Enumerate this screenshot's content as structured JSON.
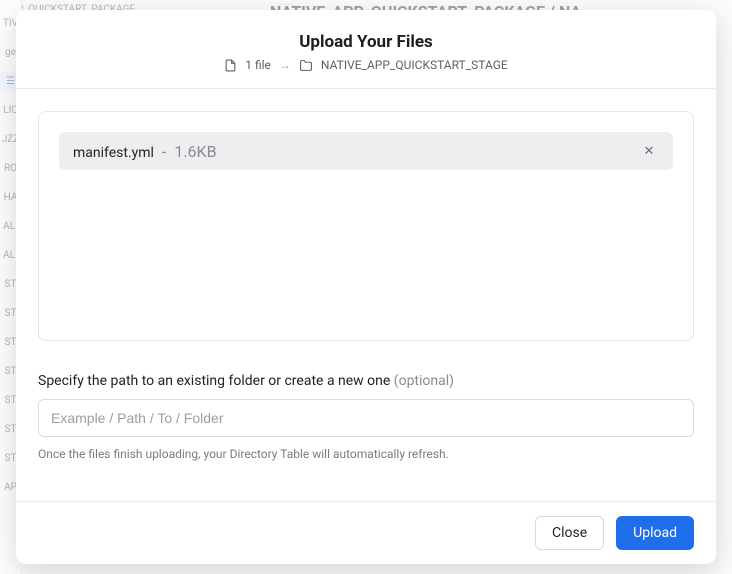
{
  "bg": {
    "header_fragment": "_APP_QUICKSTART_PACKAGE",
    "breadcrumb": "NATIVE_APP_QUICKSTART_PACKAGE / NA",
    "sidebar_items": [
      "TIV",
      "ge",
      "☰",
      "LIC",
      "JZZ",
      "RO",
      "HA",
      "ALI",
      "ALI",
      "ST",
      "ST",
      "ST",
      "ST",
      "ST",
      "ST",
      "ST",
      "AP"
    ]
  },
  "modal": {
    "title": "Upload Your Files",
    "file_count_label": "1 file",
    "destination": "NATIVE_APP_QUICKSTART_STAGE",
    "files": [
      {
        "name": "manifest.yml",
        "sep": " - ",
        "size": "1.6KB"
      }
    ],
    "path_label_text": "Specify the path to an existing folder or create a new one ",
    "path_optional": "(optional)",
    "path_placeholder": "Example / Path / To / Folder",
    "path_hint": "Once the files finish uploading, your Directory Table will automatically refresh.",
    "buttons": {
      "close": "Close",
      "upload": "Upload"
    }
  }
}
